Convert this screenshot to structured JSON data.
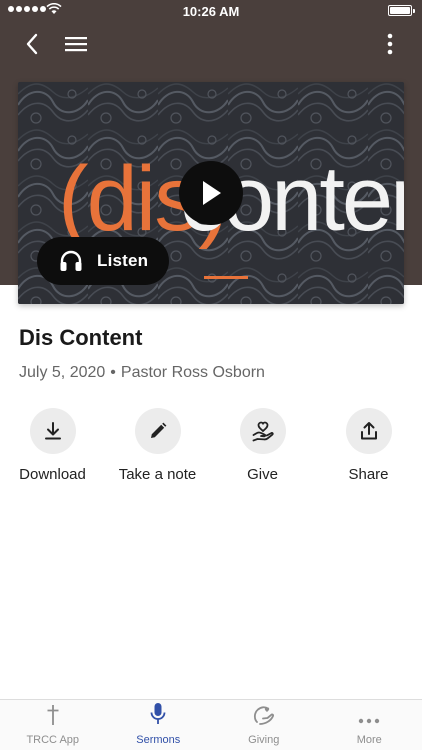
{
  "status_bar": {
    "time": "10:26 AM"
  },
  "nav": {
    "back_icon": "chevron-left-icon",
    "menu_icon": "hamburger-icon",
    "more_icon": "vertical-dots-icon"
  },
  "hero": {
    "art_text_left": "(dis)",
    "art_text_right": "content",
    "listen_label": "Listen",
    "accent_color": "#e8733a"
  },
  "sermon": {
    "title": "Dis Content",
    "date": "July 5, 2020",
    "separator": "•",
    "speaker": "Pastor Ross Osborn"
  },
  "actions": [
    {
      "label": "Download",
      "icon": "download-icon"
    },
    {
      "label": "Take a note",
      "icon": "pencil-icon"
    },
    {
      "label": "Give",
      "icon": "hand-heart-icon"
    },
    {
      "label": "Share",
      "icon": "share-icon"
    }
  ],
  "tabs": [
    {
      "label": "TRCC App",
      "icon": "cross-icon",
      "active": false
    },
    {
      "label": "Sermons",
      "icon": "microphone-icon",
      "active": true
    },
    {
      "label": "Giving",
      "icon": "giving-icon",
      "active": false
    },
    {
      "label": "More",
      "icon": "horizontal-dots-icon",
      "active": false
    }
  ],
  "colors": {
    "header_bg": "#4a3f3c",
    "active_tab": "#3150a8",
    "accent": "#e8733a"
  }
}
